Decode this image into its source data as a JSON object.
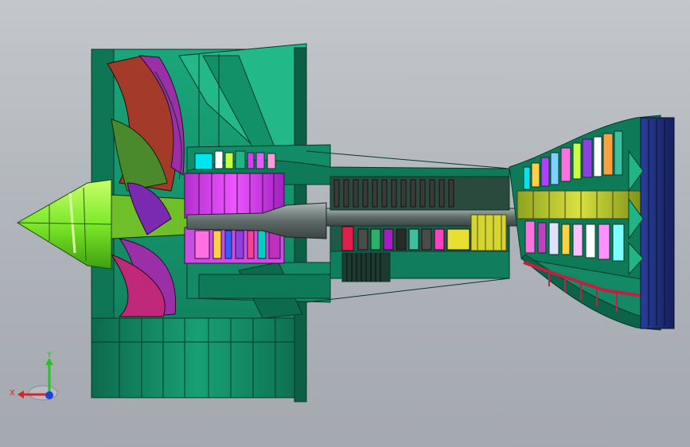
{
  "viewport": {
    "background_top": "#c3c7cc",
    "background_bottom": "#a4a9af"
  },
  "model": {
    "description_icon": "turbofan-engine-cutaway",
    "colors": {
      "casing": "#138a65",
      "casing_dark": "#0e6b4e",
      "casing_light": "#1fb585",
      "spinner": "#7ce82a",
      "fan_purple": "#9b2fa8",
      "fan_red": "#a33a2a",
      "compressor_magenta": "#d83cf0",
      "shaft_grey": "#7c8a86",
      "turbine_yellow": "#c9d23a",
      "exhaust_navy": "#1d2e78",
      "pipe_red": "#c22040"
    }
  },
  "triad": {
    "x_label": "X",
    "y_label": "Y",
    "x_color": "#e0202a",
    "y_color": "#2bc02b",
    "z_color": "#2040e0"
  }
}
